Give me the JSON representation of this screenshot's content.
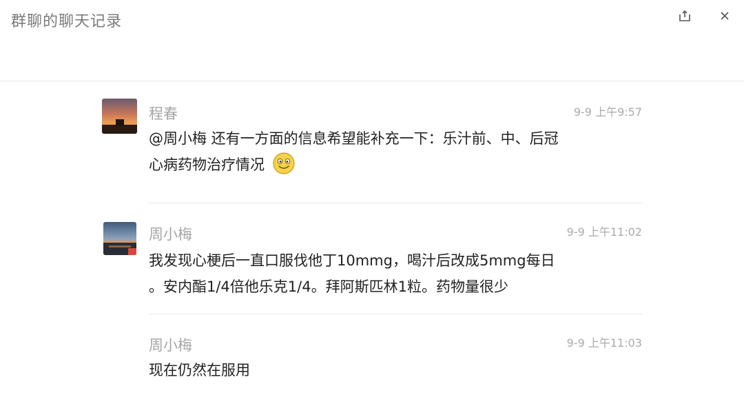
{
  "window": {
    "title": "群聊的聊天记录"
  },
  "icons": {
    "share": "share-export-icon",
    "close": "close-icon",
    "emoji": "smile-emoji-icon"
  },
  "messages": [
    {
      "sender": "程春",
      "time": "9-9 上午9:57",
      "lines": [
        "@周小梅 还有一方面的信息希望能补充一下：乐汁前、中、后冠",
        "心病药物治疗情况"
      ],
      "has_emoji": true
    },
    {
      "sender": "周小梅",
      "time": "9-9 上午11:02",
      "lines": [
        "我发现心梗后一直口服伐他丁10mmg，喝汁后改成5mmg每日",
        "。安内酯1/4倍他乐克1/4。拜阿斯匹林1粒。药物量很少"
      ],
      "has_emoji": false
    },
    {
      "sender": "周小梅",
      "time": "9-9 上午11:03",
      "lines": [
        "现在仍然在服用"
      ],
      "has_emoji": false
    }
  ]
}
